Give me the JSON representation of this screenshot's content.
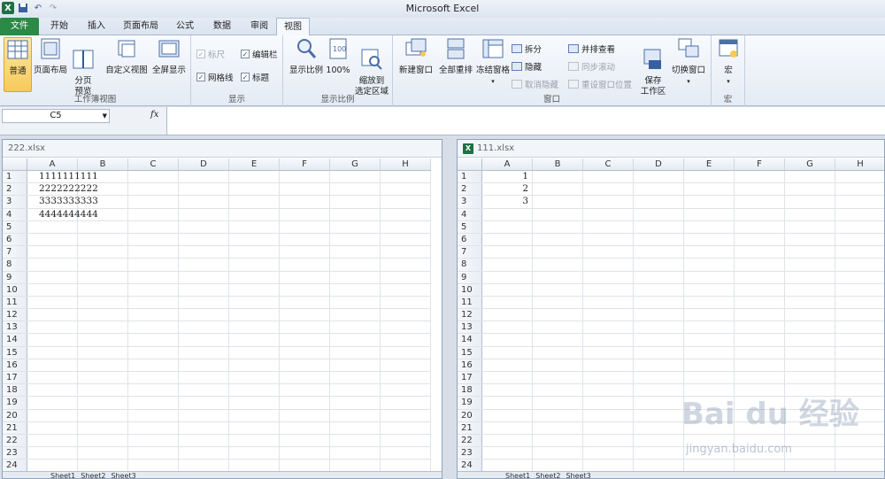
{
  "app": {
    "title": "Microsoft Excel"
  },
  "tabs": [
    "文件",
    "开始",
    "插入",
    "页面布局",
    "公式",
    "数据",
    "审阅",
    "视图"
  ],
  "ribbon": {
    "workbook_views": {
      "label": "工作簿视图",
      "normal": "普通",
      "page_layout": "页面布局",
      "page_break": "分页\n预览",
      "custom_views": "自定义视图",
      "full_screen": "全屏显示"
    },
    "show": {
      "label": "显示",
      "ruler": "标尺",
      "formula_bar": "编辑栏",
      "gridlines": "网格线",
      "headings": "标题"
    },
    "zoom": {
      "label": "显示比例",
      "zoom": "显示比例",
      "hundred": "100%",
      "zoom_selection": "缩放到\n选定区域"
    },
    "window": {
      "label": "窗口",
      "new_window": "新建窗口",
      "arrange_all": "全部重排",
      "freeze_panes": "冻结窗格",
      "split": "拆分",
      "hide": "隐藏",
      "unhide": "取消隐藏",
      "side_by_side": "并排查看",
      "sync_scroll": "同步滚动",
      "reset_position": "重设窗口位置",
      "save_workspace": "保存\n工作区",
      "switch_windows": "切换窗口"
    },
    "macros": {
      "label": "宏",
      "macros": "宏"
    }
  },
  "formula_bar": {
    "name_box": "C5",
    "fx": "fx",
    "value": ""
  },
  "workbook_left": {
    "title": "222.xlsx",
    "columns": [
      "A",
      "B",
      "C",
      "D",
      "E",
      "F",
      "G",
      "H"
    ],
    "rows": [
      "1",
      "2",
      "3",
      "4",
      "5",
      "6",
      "7",
      "8",
      "9",
      "10",
      "11",
      "12",
      "13",
      "14",
      "15",
      "16",
      "17",
      "18",
      "19",
      "20",
      "21",
      "22",
      "23",
      "24"
    ],
    "cells": [
      "1111111111",
      "2222222222",
      "3333333333",
      "4444444444"
    ],
    "sheets": [
      "Sheet1",
      "Sheet2",
      "Sheet3"
    ]
  },
  "workbook_right": {
    "title": "111.xlsx",
    "columns": [
      "A",
      "B",
      "C",
      "D",
      "E",
      "F",
      "G",
      "H"
    ],
    "rows": [
      "1",
      "2",
      "3",
      "4",
      "5",
      "6",
      "7",
      "8",
      "9",
      "10",
      "11",
      "12",
      "13",
      "14",
      "15",
      "16",
      "17",
      "18",
      "19",
      "20",
      "21",
      "22",
      "23",
      "24"
    ],
    "cells": [
      "1",
      "2",
      "3"
    ],
    "sheets": [
      "Sheet1",
      "Sheet2",
      "Sheet3"
    ]
  },
  "watermark": {
    "logo": "Bai du 经验",
    "url": "jingyan.baidu.com"
  },
  "colors": {
    "file_tab": "#2a8a46",
    "active_button": "#f7c95a",
    "excel_green": "#1e7145"
  }
}
